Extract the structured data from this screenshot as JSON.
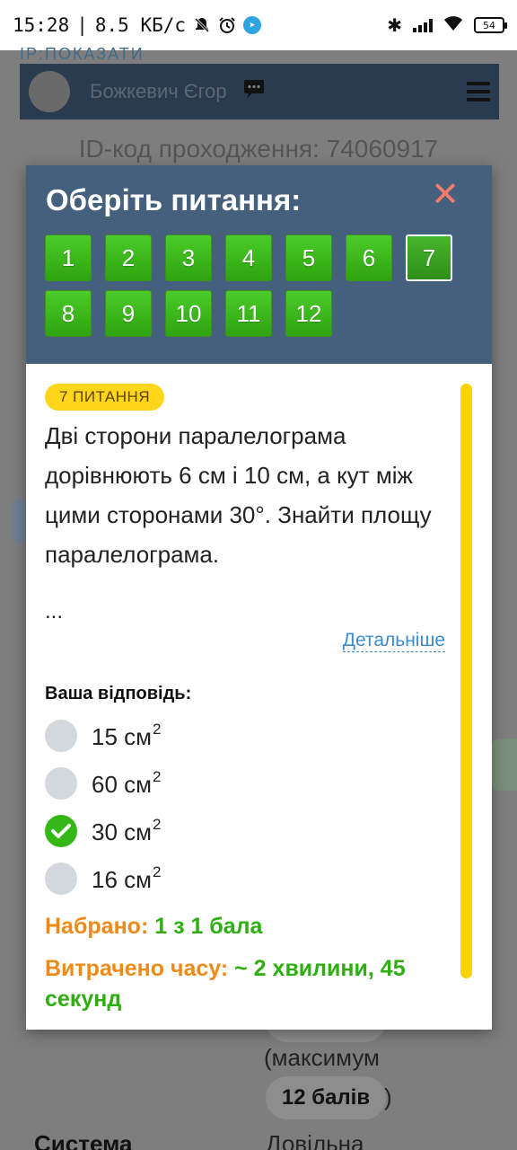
{
  "status_bar": {
    "time": "15:28",
    "speed": "8.5  КБ/с",
    "battery": "54"
  },
  "background": {
    "ip_label": "IP:ПОКАЗАТИ",
    "user_name": "Божкевич Єгор",
    "attempt_id": "ID-код проходження: 74060917",
    "max_label": "(максимум",
    "max_points": "12 балів",
    "max_close": ")",
    "system_label": "Система",
    "system_value": "Довільна"
  },
  "modal": {
    "title": "Оберіть питання:",
    "question_buttons": [
      "1",
      "2",
      "3",
      "4",
      "5",
      "6",
      "7",
      "8",
      "9",
      "10",
      "11",
      "12"
    ],
    "current_question": "7",
    "question_badge": "7 ПИТАННЯ",
    "question_text": "Дві сторони паралелограма дорівнюють 6 см і 10 см, а кут між цими сторонами 30°. Знайти площу паралелограма.",
    "ellipsis": "...",
    "details_link": "Детальніше",
    "your_answer_label": "Ваша відповідь:",
    "options": [
      {
        "text": "15 см",
        "sup": "2",
        "checked": false
      },
      {
        "text": "60 см",
        "sup": "2",
        "checked": false
      },
      {
        "text": "30 см",
        "sup": "2",
        "checked": true
      },
      {
        "text": "16 см",
        "sup": "2",
        "checked": false
      }
    ],
    "score_label": "Набрано:",
    "score_value": "1 з 1 бала",
    "time_label": "Витрачено часу:",
    "time_value": "~ 2 хвилини, 45 секунд"
  },
  "colors": {
    "modal_header": "#44607d",
    "button_green": "#2ea40f",
    "badge_yellow": "#ffd61c",
    "close_red": "#f47c6c",
    "orange_text": "#f08a16",
    "green_text": "#2eae10"
  }
}
